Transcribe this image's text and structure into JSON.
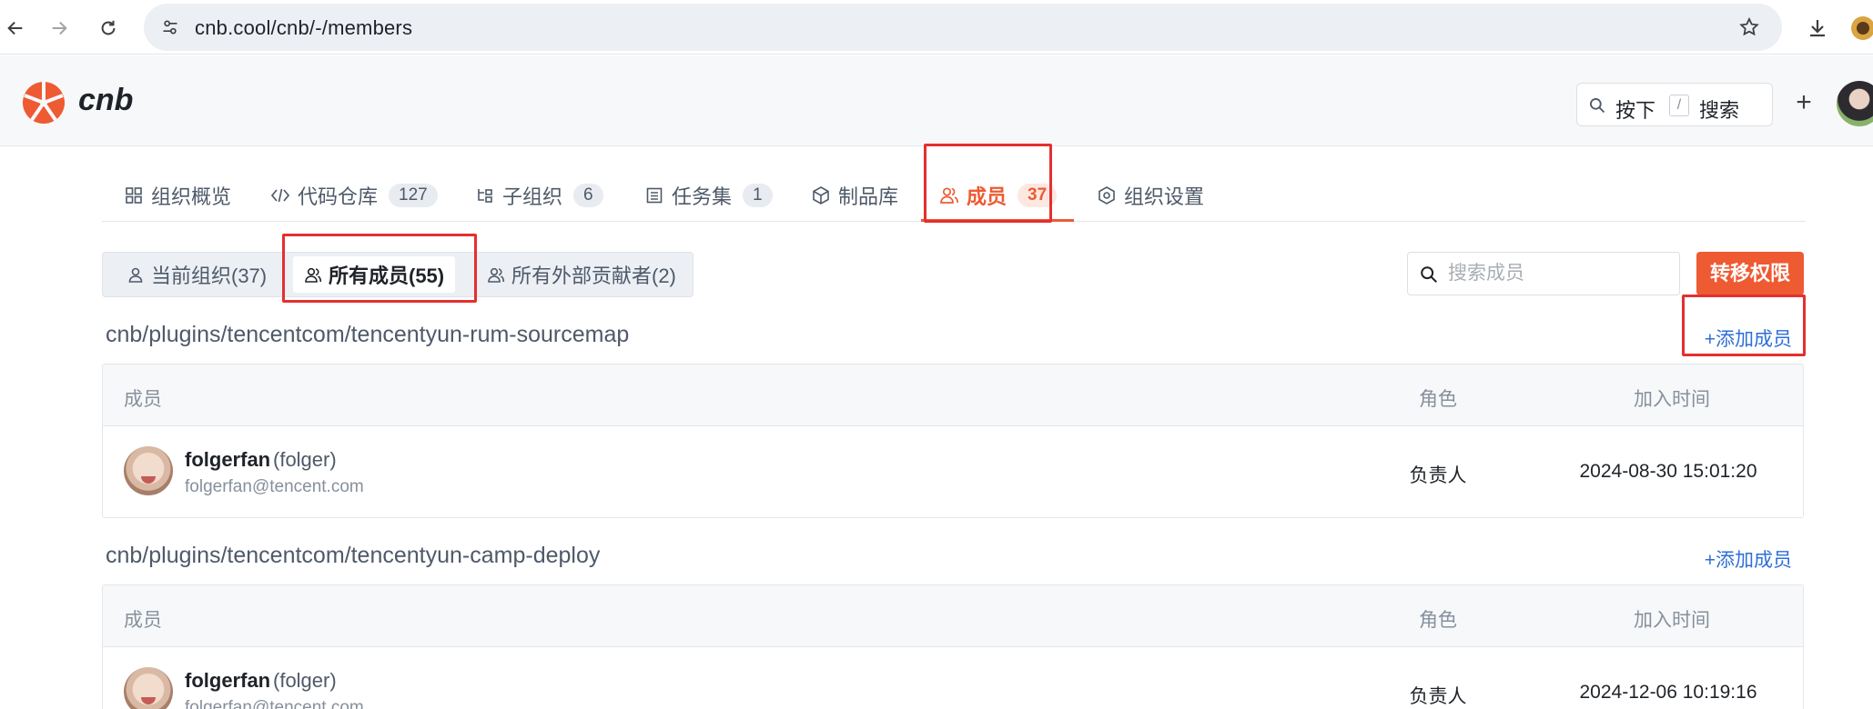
{
  "browser": {
    "url": "cnb.cool/cnb/-/members",
    "back_icon": "arrow-left-icon",
    "forward_icon": "arrow-right-icon",
    "reload_icon": "reload-icon"
  },
  "header": {
    "brand": "cnb",
    "search_press": "按下",
    "search_key": "/",
    "search_label": "搜索",
    "plus_label": "+"
  },
  "main_tabs": [
    {
      "label": "组织概览",
      "icon": "grid-icon"
    },
    {
      "label": "代码仓库",
      "count": "127",
      "icon": "code-icon"
    },
    {
      "label": "子组织",
      "count": "6",
      "icon": "tree-icon"
    },
    {
      "label": "任务集",
      "count": "1",
      "icon": "list-icon"
    },
    {
      "label": "制品库",
      "icon": "cube-icon"
    },
    {
      "label": "成员",
      "count": "37",
      "icon": "users-icon",
      "active": true
    },
    {
      "label": "组织设置",
      "icon": "gear-icon"
    }
  ],
  "sub_tabs": [
    {
      "label": "当前组织(37)"
    },
    {
      "label": "所有成员(55)",
      "active": true
    },
    {
      "label": "所有外部贡献者(2)"
    }
  ],
  "member_search": {
    "placeholder": "搜索成员"
  },
  "transfer_button": "转移权限",
  "add_member_label": "+添加成员",
  "columns": {
    "member": "成员",
    "role": "角色",
    "joined": "加入时间"
  },
  "repos": [
    {
      "name": "cnb/plugins/tencentcom/tencentyun-rum-sourcemap",
      "members": [
        {
          "name": "folgerfan",
          "handle": "(folger)",
          "email": "folgerfan@tencent.com",
          "role": "负责人",
          "joined": "2024-08-30 15:01:20"
        }
      ]
    },
    {
      "name": "cnb/plugins/tencentcom/tencentyun-camp-deploy",
      "members": [
        {
          "name": "folgerfan",
          "handle": "(folger)",
          "email": "folgerfan@tencent.com",
          "role": "负责人",
          "joined": "2024-12-06 10:19:16"
        }
      ]
    }
  ],
  "colors": {
    "accent": "#ee5a32",
    "link": "#2f6fd6",
    "annotation": "#e52f2f"
  }
}
